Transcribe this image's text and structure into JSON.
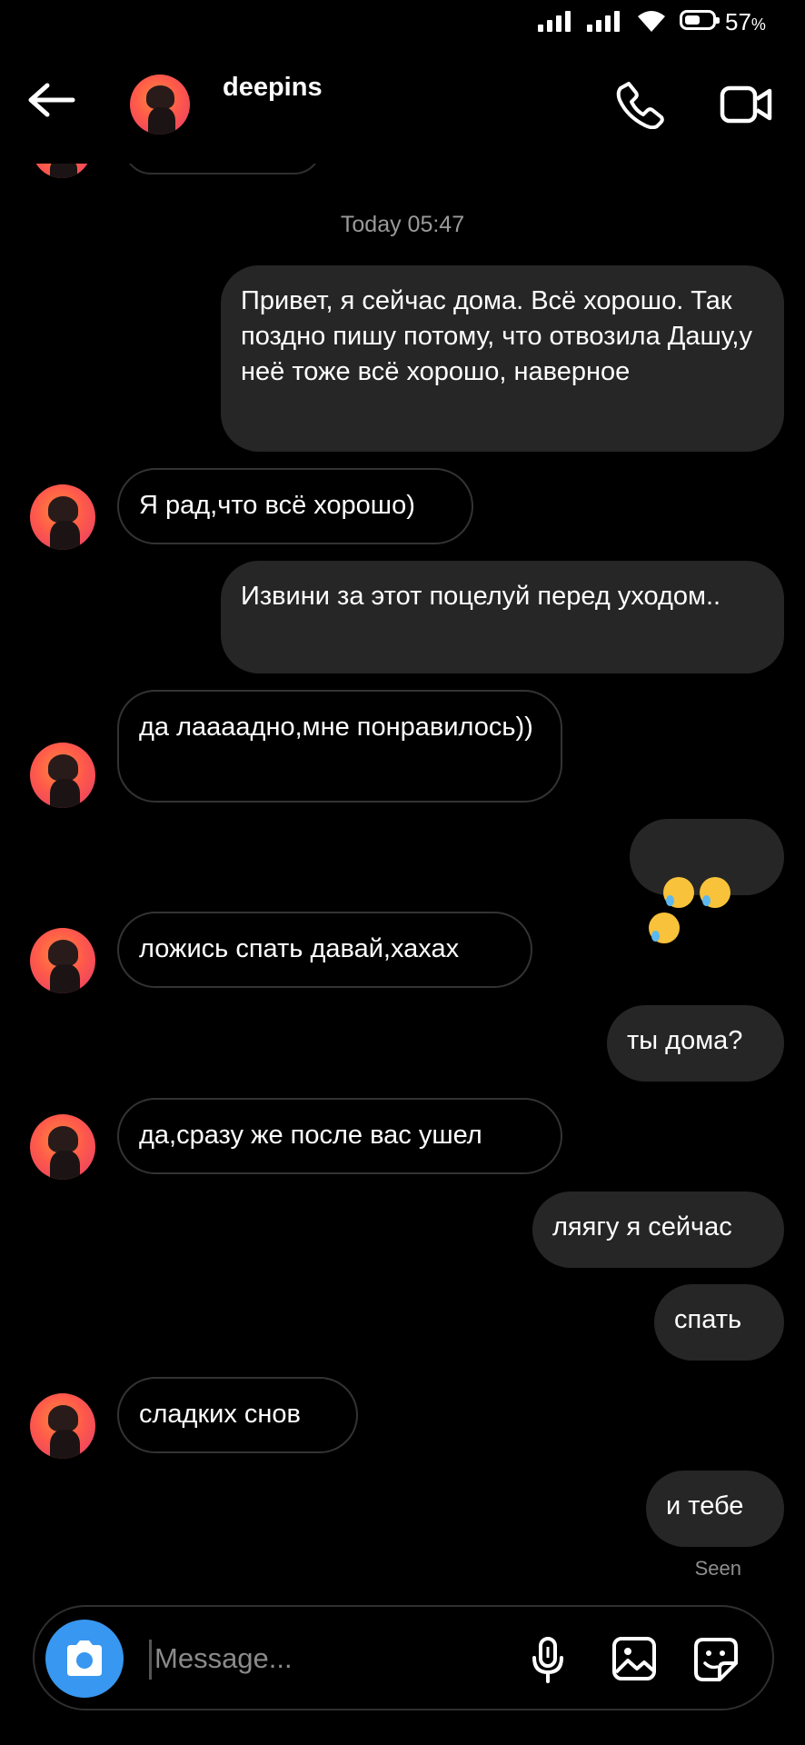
{
  "status_bar": {
    "battery_percent": "57",
    "battery_unit": "%",
    "battery_level": 0.57
  },
  "header": {
    "username": "deepins"
  },
  "conversation": {
    "timestamp": "Today 05:47",
    "messages": [
      {
        "side": "sent",
        "text": "Привет, я сейчас дома. Всё хорошо. Так поздно пишу потому, что отвозила Дашу,у неё тоже всё хорошо, наверное"
      },
      {
        "side": "received",
        "text": "Я рад,что всё хорошо)"
      },
      {
        "side": "sent",
        "text": "Извини за этот поцелуй перед уходом.."
      },
      {
        "side": "received",
        "text": "да лаааадно,мне понравилось))"
      },
      {
        "side": "sent",
        "text": "",
        "emojis": [
          "crying-face",
          "crying-face",
          "crying-face"
        ]
      },
      {
        "side": "received",
        "text": "ложись спать давай,хахах"
      },
      {
        "side": "sent",
        "text": "ты дома?"
      },
      {
        "side": "received",
        "text": "да,сразу же после вас ушел"
      },
      {
        "side": "sent",
        "text": "ляягу я сейчас"
      },
      {
        "side": "sent",
        "text": "спать"
      },
      {
        "side": "received",
        "text": "сладких снов"
      },
      {
        "side": "sent",
        "text": "и тебе"
      }
    ],
    "seen_label": "Seen"
  },
  "composer": {
    "placeholder": "Message..."
  },
  "colors": {
    "accent": "#3897f0",
    "sent_bubble": "#262626",
    "background": "#000000"
  }
}
